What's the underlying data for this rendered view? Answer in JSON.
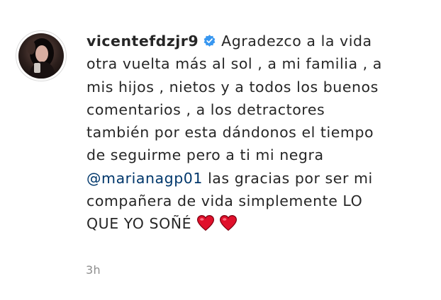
{
  "comment": {
    "username": "vicentefdzjr9",
    "verified_icon": "verified-badge-icon",
    "lines": [
      "Agradezco a la vida",
      "otra vuelta más al sol , a mi familia , a",
      "mis hijos , nietos y a todos los buenos",
      "comentarios , a los detractores",
      "también por esta dándonos el tiempo",
      "de seguirme pero a ti mi negra",
      "las gracias por ser mi",
      "compañera de vida simplemente LO",
      "QUE YO SOÑÉ"
    ],
    "mention": "@marianagp01",
    "emoji": [
      "heart-emoji-icon",
      "heart-emoji-icon"
    ],
    "timestamp": "3h"
  },
  "colors": {
    "text": "#262626",
    "mention": "#00376b",
    "verified": "#3897f0",
    "muted": "#8e8e8e",
    "heart": "#e0102b"
  }
}
